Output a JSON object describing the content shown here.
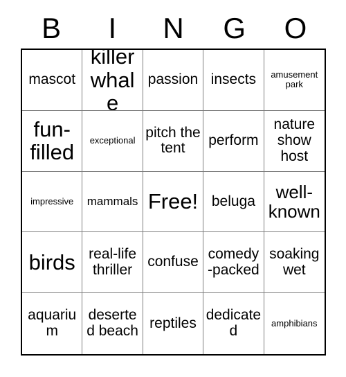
{
  "header": {
    "letters": [
      "B",
      "I",
      "N",
      "G",
      "O"
    ]
  },
  "grid": {
    "columns": 5,
    "rows": 5,
    "border_color": "#000000",
    "divider_color": "#7d7d7d",
    "background": "#ffffff",
    "text_color": "#000000",
    "cells": [
      {
        "text": "mascot",
        "size": "md"
      },
      {
        "text": "killer whale",
        "size": "xl"
      },
      {
        "text": "passion",
        "size": "md"
      },
      {
        "text": "insects",
        "size": "md"
      },
      {
        "text": "amusement park",
        "size": "xs"
      },
      {
        "text": "fun-filled",
        "size": "xl"
      },
      {
        "text": "exceptional",
        "size": "xs"
      },
      {
        "text": "pitch the tent",
        "size": "md"
      },
      {
        "text": "perform",
        "size": "md"
      },
      {
        "text": "nature show host",
        "size": "md"
      },
      {
        "text": "impressive",
        "size": "xs"
      },
      {
        "text": "mammals",
        "size": "sm"
      },
      {
        "text": "Free!",
        "size": "xl"
      },
      {
        "text": "beluga",
        "size": "md"
      },
      {
        "text": "well-known",
        "size": "lg"
      },
      {
        "text": "birds",
        "size": "xl"
      },
      {
        "text": "real-life thriller",
        "size": "md"
      },
      {
        "text": "confuse",
        "size": "md"
      },
      {
        "text": "comedy-packed",
        "size": "md"
      },
      {
        "text": "soaking wet",
        "size": "md"
      },
      {
        "text": "aquarium",
        "size": "md"
      },
      {
        "text": "deserted beach",
        "size": "md"
      },
      {
        "text": "reptiles",
        "size": "md"
      },
      {
        "text": "dedicated",
        "size": "md"
      },
      {
        "text": "amphibians",
        "size": "xs"
      }
    ]
  }
}
